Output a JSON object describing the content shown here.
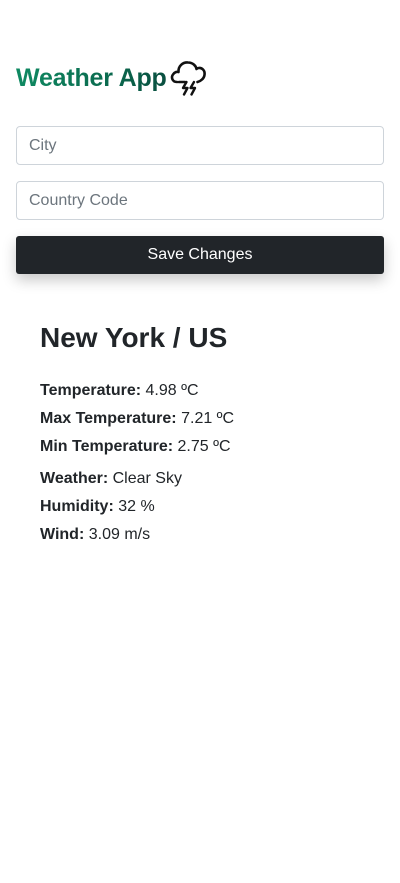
{
  "header": {
    "title": "Weather App",
    "icon": "thunderstorm-cloud-icon"
  },
  "form": {
    "city_placeholder": "City",
    "city_value": "",
    "country_placeholder": "Country Code",
    "country_value": "",
    "save_label": "Save Changes"
  },
  "weather": {
    "location": "New York / US",
    "temperature": {
      "label": "Temperature:",
      "value": "4.98 ºC"
    },
    "max_temperature": {
      "label": "Max Temperature:",
      "value": "7.21 ºC"
    },
    "min_temperature": {
      "label": "Min Temperature:",
      "value": "2.75 ºC"
    },
    "condition": {
      "label": "Weather:",
      "value": "Clear Sky"
    },
    "humidity": {
      "label": "Humidity:",
      "value": "32 %"
    },
    "wind": {
      "label": "Wind:",
      "value": "3.09 m/s"
    }
  },
  "colors": {
    "brand_green": "#0f8a62",
    "button_dark": "#212529",
    "text": "#212529",
    "input_border": "#ced4da"
  }
}
